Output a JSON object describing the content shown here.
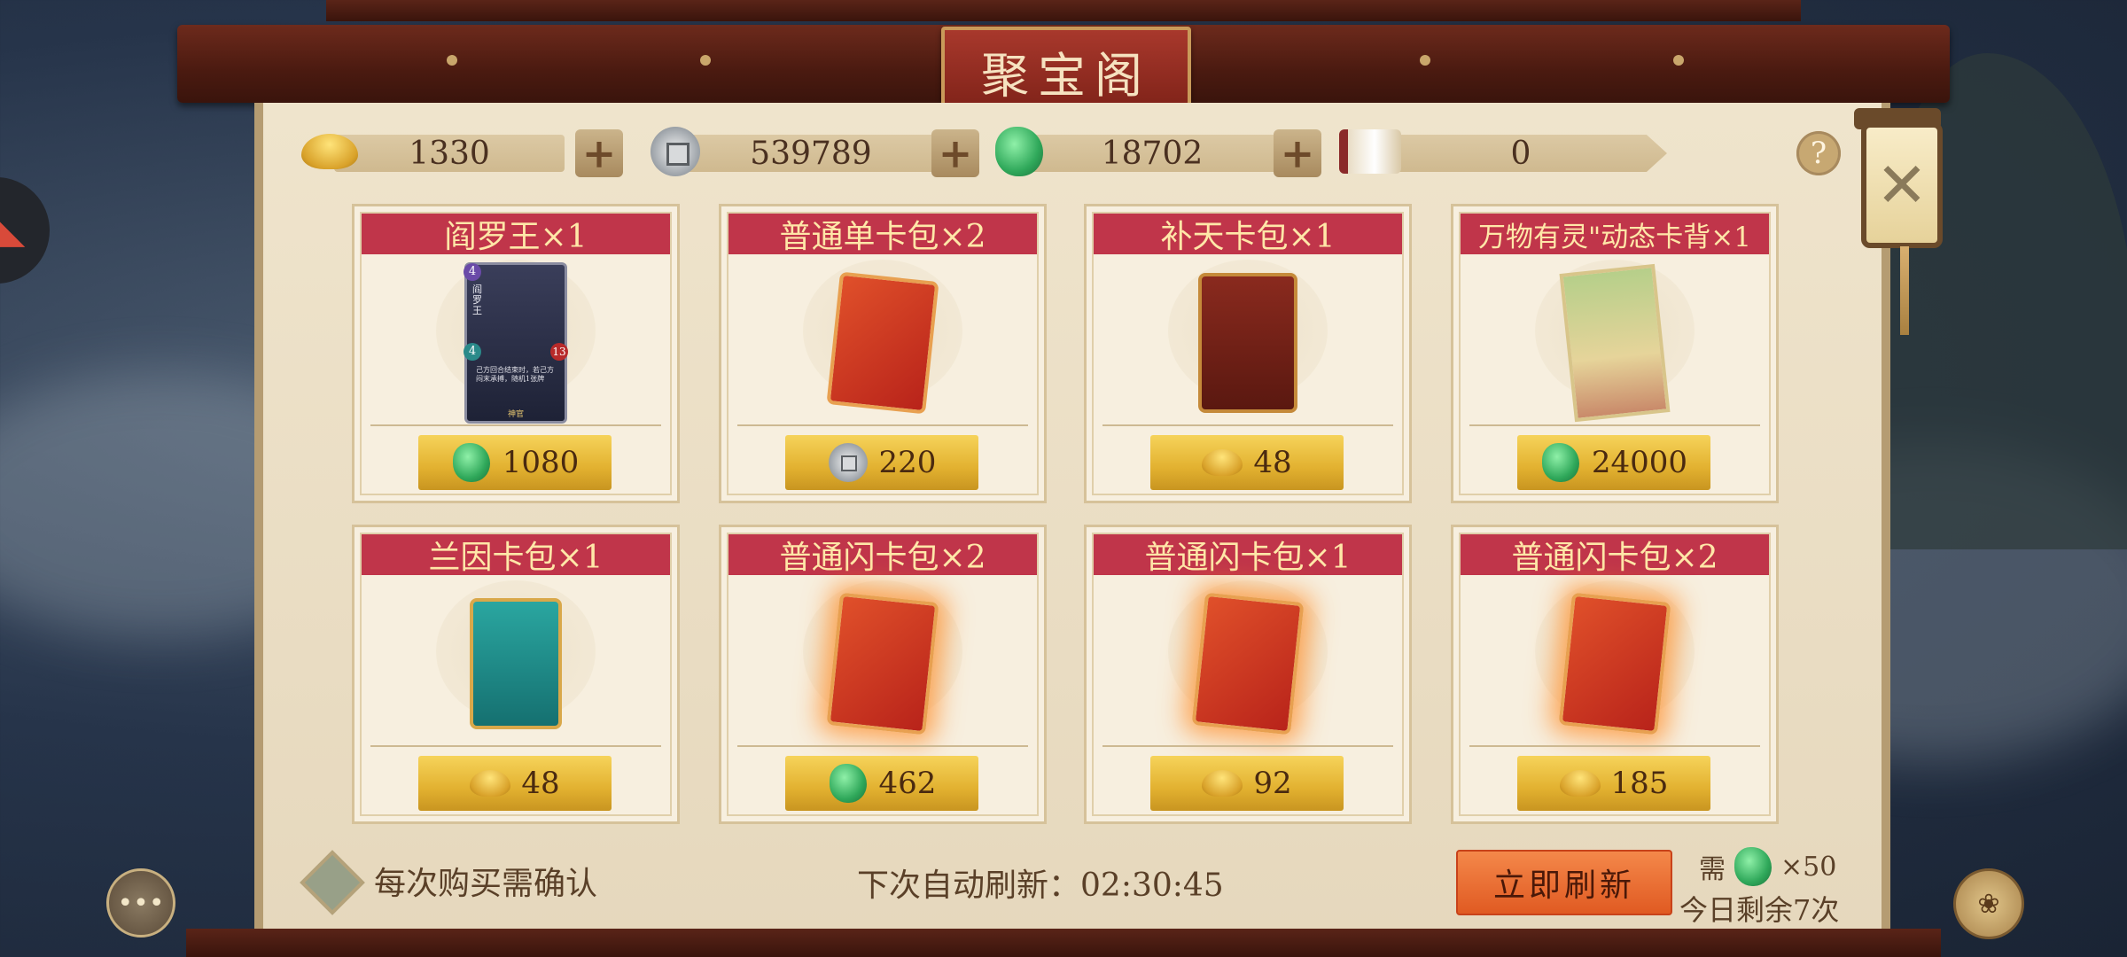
{
  "title": "聚宝阁",
  "currencies": [
    {
      "name": "gold-ingot",
      "value": "1330"
    },
    {
      "name": "silver-coin",
      "value": "539789"
    },
    {
      "name": "jade",
      "value": "18702"
    },
    {
      "name": "scroll",
      "value": "0"
    }
  ],
  "help_label": "?",
  "cards": [
    {
      "title": "阎罗王×1",
      "price": "1080",
      "currency": "jade"
    },
    {
      "title": "普通单卡包×2",
      "price": "220",
      "currency": "silver-coin"
    },
    {
      "title": "补天卡包×1",
      "price": "48",
      "currency": "gold-ingot"
    },
    {
      "title": "万物有灵\"动态卡背×1",
      "price": "24000",
      "currency": "jade"
    },
    {
      "title": "兰因卡包×1",
      "price": "48",
      "currency": "gold-ingot"
    },
    {
      "title": "普通闪卡包×2",
      "price": "462",
      "currency": "jade"
    },
    {
      "title": "普通闪卡包×1",
      "price": "92",
      "currency": "gold-ingot"
    },
    {
      "title": "普通闪卡包×2",
      "price": "185",
      "currency": "gold-ingot"
    }
  ],
  "hero_card": {
    "cost": "4",
    "attack": "4",
    "health": "13",
    "name": "阎罗王",
    "text": "己方回合结束时，若己方闷末承搏，随机1张牌",
    "footer": "神官"
  },
  "footer": {
    "confirm_label": "每次购买需确认",
    "auto_refresh_label": "下次自动刷新：",
    "auto_refresh_time": "02:30:45",
    "refresh_button": "立即刷新",
    "need_label": "需",
    "need_cost": "×50",
    "remaining": "今日剩余7次"
  },
  "close_label": "✕",
  "chat_label": "•••"
}
